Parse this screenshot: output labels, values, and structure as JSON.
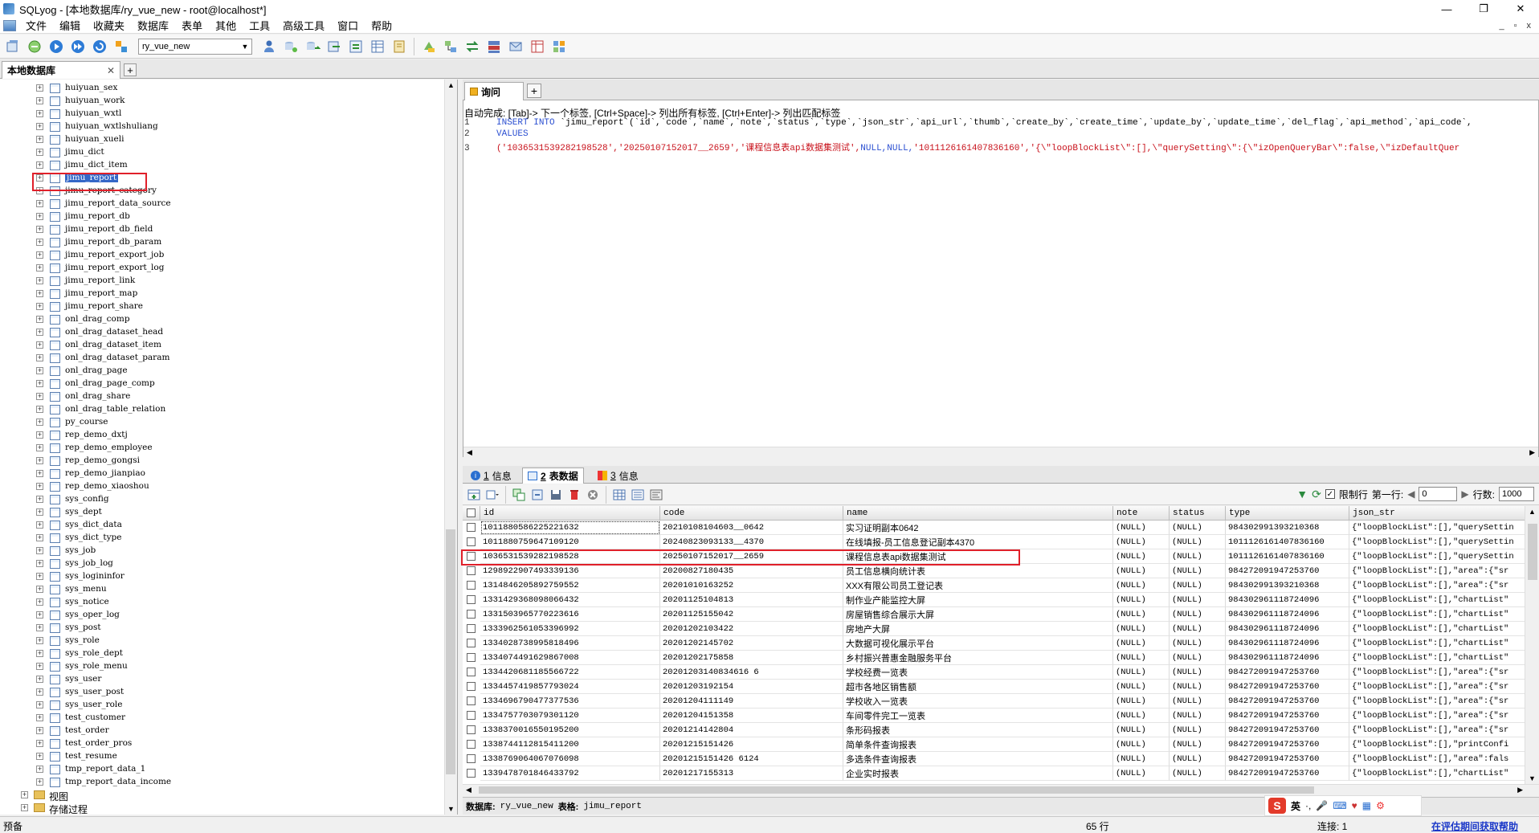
{
  "window": {
    "title": "SQLyog - [本地数据库/ry_vue_new - root@localhost*]",
    "minimize": "—",
    "maximize": "❐",
    "close": "✕"
  },
  "menu": {
    "items": [
      "文件",
      "编辑",
      "收藏夹",
      "数据库",
      "表单",
      "其他",
      "工具",
      "高级工具",
      "窗口",
      "帮助"
    ],
    "mdi_min": "_",
    "mdi_restore": "▫",
    "mdi_close": "x"
  },
  "toolbar": {
    "database": "ry_vue_new"
  },
  "connection_tab": {
    "label": "本地数据库",
    "close": "✕",
    "add": "+"
  },
  "tree": {
    "tables": [
      "huiyuan_sex",
      "huiyuan_work",
      "huiyuan_wxtl",
      "huiyuan_wxtlshuliang",
      "huiyuan_xueli",
      "jimu_dict",
      "jimu_dict_item",
      "jimu_report",
      "jimu_report_category",
      "jimu_report_data_source",
      "jimu_report_db",
      "jimu_report_db_field",
      "jimu_report_db_param",
      "jimu_report_export_job",
      "jimu_report_export_log",
      "jimu_report_link",
      "jimu_report_map",
      "jimu_report_share",
      "onl_drag_comp",
      "onl_drag_dataset_head",
      "onl_drag_dataset_item",
      "onl_drag_dataset_param",
      "onl_drag_page",
      "onl_drag_page_comp",
      "onl_drag_share",
      "onl_drag_table_relation",
      "py_course",
      "rep_demo_dxtj",
      "rep_demo_employee",
      "rep_demo_gongsi",
      "rep_demo_jianpiao",
      "rep_demo_xiaoshou",
      "sys_config",
      "sys_dept",
      "sys_dict_data",
      "sys_dict_type",
      "sys_job",
      "sys_job_log",
      "sys_logininfor",
      "sys_menu",
      "sys_notice",
      "sys_oper_log",
      "sys_post",
      "sys_role",
      "sys_role_dept",
      "sys_role_menu",
      "sys_user",
      "sys_user_post",
      "sys_user_role",
      "test_customer",
      "test_order",
      "test_order_pros",
      "test_resume",
      "tmp_report_data_1",
      "tmp_report_data_income"
    ],
    "selected": "jimu_report",
    "folders": [
      "视图",
      "存储过程"
    ]
  },
  "query_tab": {
    "label": "询问",
    "add": "+"
  },
  "editor": {
    "hint": "自动完成: [Tab]-> 下一个标签, [Ctrl+Space]-> 列出所有标签, [Ctrl+Enter]-> 列出匹配标签",
    "line1_kw1": "INSERT",
    "line1_kw2": "INTO",
    "line1_rest": "`jimu_report`(`id`,`code`,`name`,`note`,`status`,`type`,`json_str`,`api_url`,`thumb`,`create_by`,`create_time`,`update_by`,`update_time`,`del_flag`,`api_method`,`api_code`,",
    "line2": "VALUES",
    "line3_a": "('1036531539282198528','20250107152017__2659','课程信息表api数据集测试',",
    "line3_null": "NULL,NULL,",
    "line3_b": "'1011126161407836160','{\\\"loopBlockList\\\":[],\\\"querySetting\\\":{\\\"izOpenQueryBar\\\":false,\\\"izDefaultQuer",
    "line_numbers": [
      "1",
      "2",
      "3"
    ]
  },
  "result_tabs": [
    {
      "num": "1",
      "label": "信息"
    },
    {
      "num": "2",
      "label": "表数据"
    },
    {
      "num": "3",
      "label": "信息"
    }
  ],
  "result_toolbar": {
    "limit_label": "限制行",
    "first_row_label": "第一行:",
    "first_row": "0",
    "rows_label": "行数:",
    "rows": "1000"
  },
  "grid": {
    "columns": [
      "id",
      "code",
      "name",
      "note",
      "status",
      "type",
      "json_str"
    ],
    "rows": [
      [
        "1011880586225221632",
        "20210108104603__0642",
        "实习证明副本0642",
        "(NULL)",
        "(NULL)",
        "984302991393210368",
        "{\"loopBlockList\":[],\"querySettin"
      ],
      [
        "1011880759647109120",
        "20240823093133__4370",
        "在线填报-员工信息登记副本4370",
        "(NULL)",
        "(NULL)",
        "1011126161407836160",
        "{\"loopBlockList\":[],\"querySettin"
      ],
      [
        "1036531539282198528",
        "20250107152017__2659",
        "课程信息表api数据集测试",
        "(NULL)",
        "(NULL)",
        "1011126161407836160",
        "{\"loopBlockList\":[],\"querySettin"
      ],
      [
        "1298922907493339136",
        "20200827180435",
        "员工信息横向统计表",
        "(NULL)",
        "(NULL)",
        "984272091947253760",
        "{\"loopBlockList\":[],\"area\":{\"sr"
      ],
      [
        "1314846205892759552",
        "20201010163252",
        "XXX有限公司员工登记表",
        "(NULL)",
        "(NULL)",
        "984302991393210368",
        "{\"loopBlockList\":[],\"area\":{\"sr"
      ],
      [
        "1331429368098066432",
        "20201125104813",
        "制作业产能监控大屏",
        "(NULL)",
        "(NULL)",
        "984302961118724096",
        "{\"loopBlockList\":[],\"chartList\""
      ],
      [
        "1331503965770223616",
        "20201125155042",
        "房屋销售综合展示大屏",
        "(NULL)",
        "(NULL)",
        "984302961118724096",
        "{\"loopBlockList\":[],\"chartList\""
      ],
      [
        "1333962561053396992",
        "20201202103422",
        "房地产大屏",
        "(NULL)",
        "(NULL)",
        "984302961118724096",
        "{\"loopBlockList\":[],\"chartList\""
      ],
      [
        "1334028738995818496",
        "20201202145702",
        "大数据可视化展示平台",
        "(NULL)",
        "(NULL)",
        "984302961118724096",
        "{\"loopBlockList\":[],\"chartList\""
      ],
      [
        "1334074491629867008",
        "20201202175858",
        "乡村振兴普惠金融服务平台",
        "(NULL)",
        "(NULL)",
        "984302961118724096",
        "{\"loopBlockList\":[],\"chartList\""
      ],
      [
        "1334420681185566722",
        "20201203140834616 6",
        "学校经费一览表",
        "(NULL)",
        "(NULL)",
        "984272091947253760",
        "{\"loopBlockList\":[],\"area\":{\"sr"
      ],
      [
        "1334457419857793024",
        "20201203192154",
        "超市各地区销售额",
        "(NULL)",
        "(NULL)",
        "984272091947253760",
        "{\"loopBlockList\":[],\"area\":{\"sr"
      ],
      [
        "1334696790477377536",
        "20201204111149",
        "学校收入一览表",
        "(NULL)",
        "(NULL)",
        "984272091947253760",
        "{\"loopBlockList\":[],\"area\":{\"sr"
      ],
      [
        "1334757703079301120",
        "20201204151358",
        "车间零件完工一览表",
        "(NULL)",
        "(NULL)",
        "984272091947253760",
        "{\"loopBlockList\":[],\"area\":{\"sr"
      ],
      [
        "1338370016550195200",
        "20201214142804",
        "条形码报表",
        "(NULL)",
        "(NULL)",
        "984272091947253760",
        "{\"loopBlockList\":[],\"area\":{\"sr"
      ],
      [
        "1338744112815411200",
        "20201215151426",
        "简单条件查询报表",
        "(NULL)",
        "(NULL)",
        "984272091947253760",
        "{\"loopBlockList\":[],\"printConfi"
      ],
      [
        "1338769064067076098",
        "20201215151426 6124",
        "多选条件查询报表",
        "(NULL)",
        "(NULL)",
        "984272091947253760",
        "{\"loopBlockList\":[],\"area\":fals"
      ],
      [
        "1339478701846433792",
        "20201217155313",
        "企业实时报表",
        "(NULL)",
        "(NULL)",
        "984272091947253760",
        "{\"loopBlockList\":[],\"chartList\""
      ]
    ]
  },
  "infobar": {
    "db_label": "数据库:",
    "db": "ry_vue_new",
    "table_label": "表格:",
    "table": "jimu_report"
  },
  "status": {
    "left": "预备",
    "rows": "65 行",
    "conn": "连接: 1",
    "link": "在评估期间获取帮助"
  },
  "ime": {
    "logo": "S",
    "lang": "英"
  }
}
